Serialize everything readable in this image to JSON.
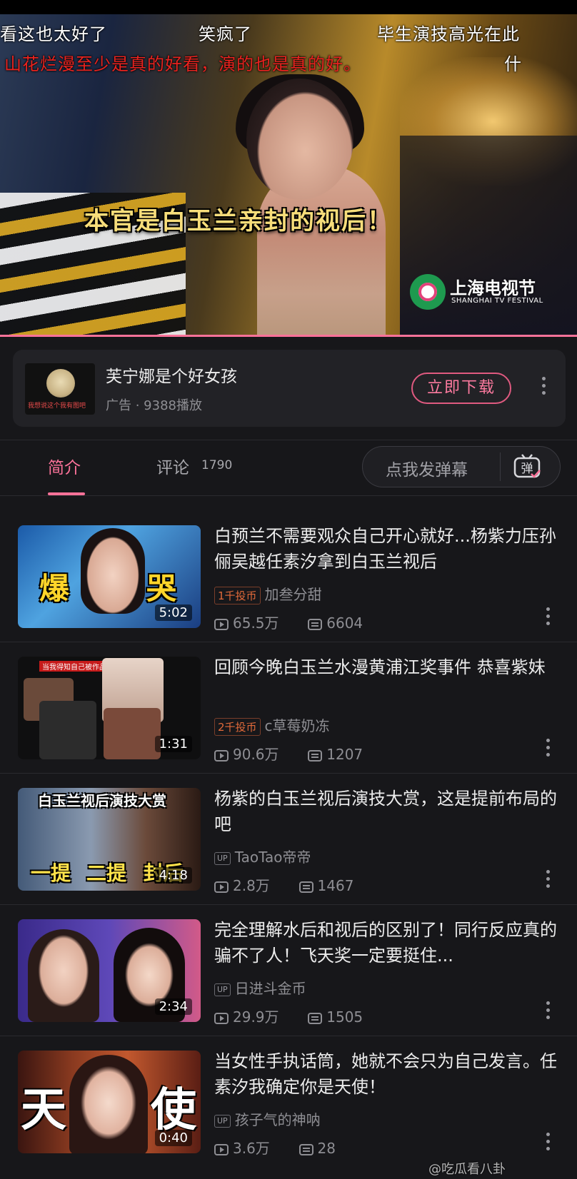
{
  "player": {
    "danmaku": [
      {
        "text": "看这也太好了",
        "color": "#ffffff"
      },
      {
        "text": "笑疯了",
        "color": "#ffffff"
      },
      {
        "text": "毕生演技高光在此",
        "color": "#ffffff"
      },
      {
        "text": "什",
        "color": "#ffffff"
      },
      {
        "text": "山花烂漫至少是真的好看，演的也是真的好。",
        "color": "#e8231f"
      }
    ],
    "subtitle": "本官是白玉兰亲封的视后！",
    "logo_cn": "上海电视节",
    "logo_en": "SHANGHAI TV FESTIVAL",
    "progress_color": "#fb7299"
  },
  "ad": {
    "title": "芙宁娜是个好女孩",
    "sub": "广告 · 9388播放",
    "thumb_caption": "我想说这个我有图吧",
    "button": "立即下载"
  },
  "tabs": {
    "intro": "简介",
    "comments": "评论",
    "comments_count": "1790",
    "danmaku_placeholder": "点我发弹幕",
    "danmaku_icon": "弹",
    "accent": "#fb7299"
  },
  "videos": [
    {
      "title": "白预兰不需要观众自己开心就好...杨紫力压孙俪吴越任素汐拿到白玉兰视后",
      "coin": "1千投币",
      "author": "加叁分甜",
      "views": "65.5万",
      "danmaku": "6604",
      "duration": "5:02",
      "thumb_text": [
        "爆",
        "哭"
      ]
    },
    {
      "title": "回顾今晚白玉兰水漫黄浦江奖事件 恭喜紫妹",
      "coin": "2千投币",
      "author": "c草莓奶冻",
      "views": "90.6万",
      "danmaku": "1207",
      "duration": "1:31",
      "thumb_text": [
        "当我得知自己被作品了bybike:"
      ]
    },
    {
      "title": "杨紫的白玉兰视后演技大赏，这是提前布局的吧",
      "up": "UP",
      "author": "TaoTao帝帝",
      "views": "2.8万",
      "danmaku": "1467",
      "duration": "4:18",
      "thumb_text": [
        "白玉兰视后演技大赏",
        "一提",
        "二提",
        "封后"
      ]
    },
    {
      "title": "完全理解水后和视后的区别了！同行反应真的骗不了人！飞天奖一定要挺住...",
      "up": "UP",
      "author": "日进斗金币",
      "views": "29.9万",
      "danmaku": "1505",
      "duration": "2:34",
      "thumb_text": []
    },
    {
      "title": "当女性手执话筒，她就不会只为自己发言。任素汐我确定你是天使！",
      "up": "UP",
      "author": "孩子气的神呐",
      "views": "3.6万",
      "danmaku": "28",
      "duration": "0:40",
      "thumb_text": [
        "天",
        "使"
      ]
    }
  ],
  "watermark": "@吃瓜看八卦"
}
